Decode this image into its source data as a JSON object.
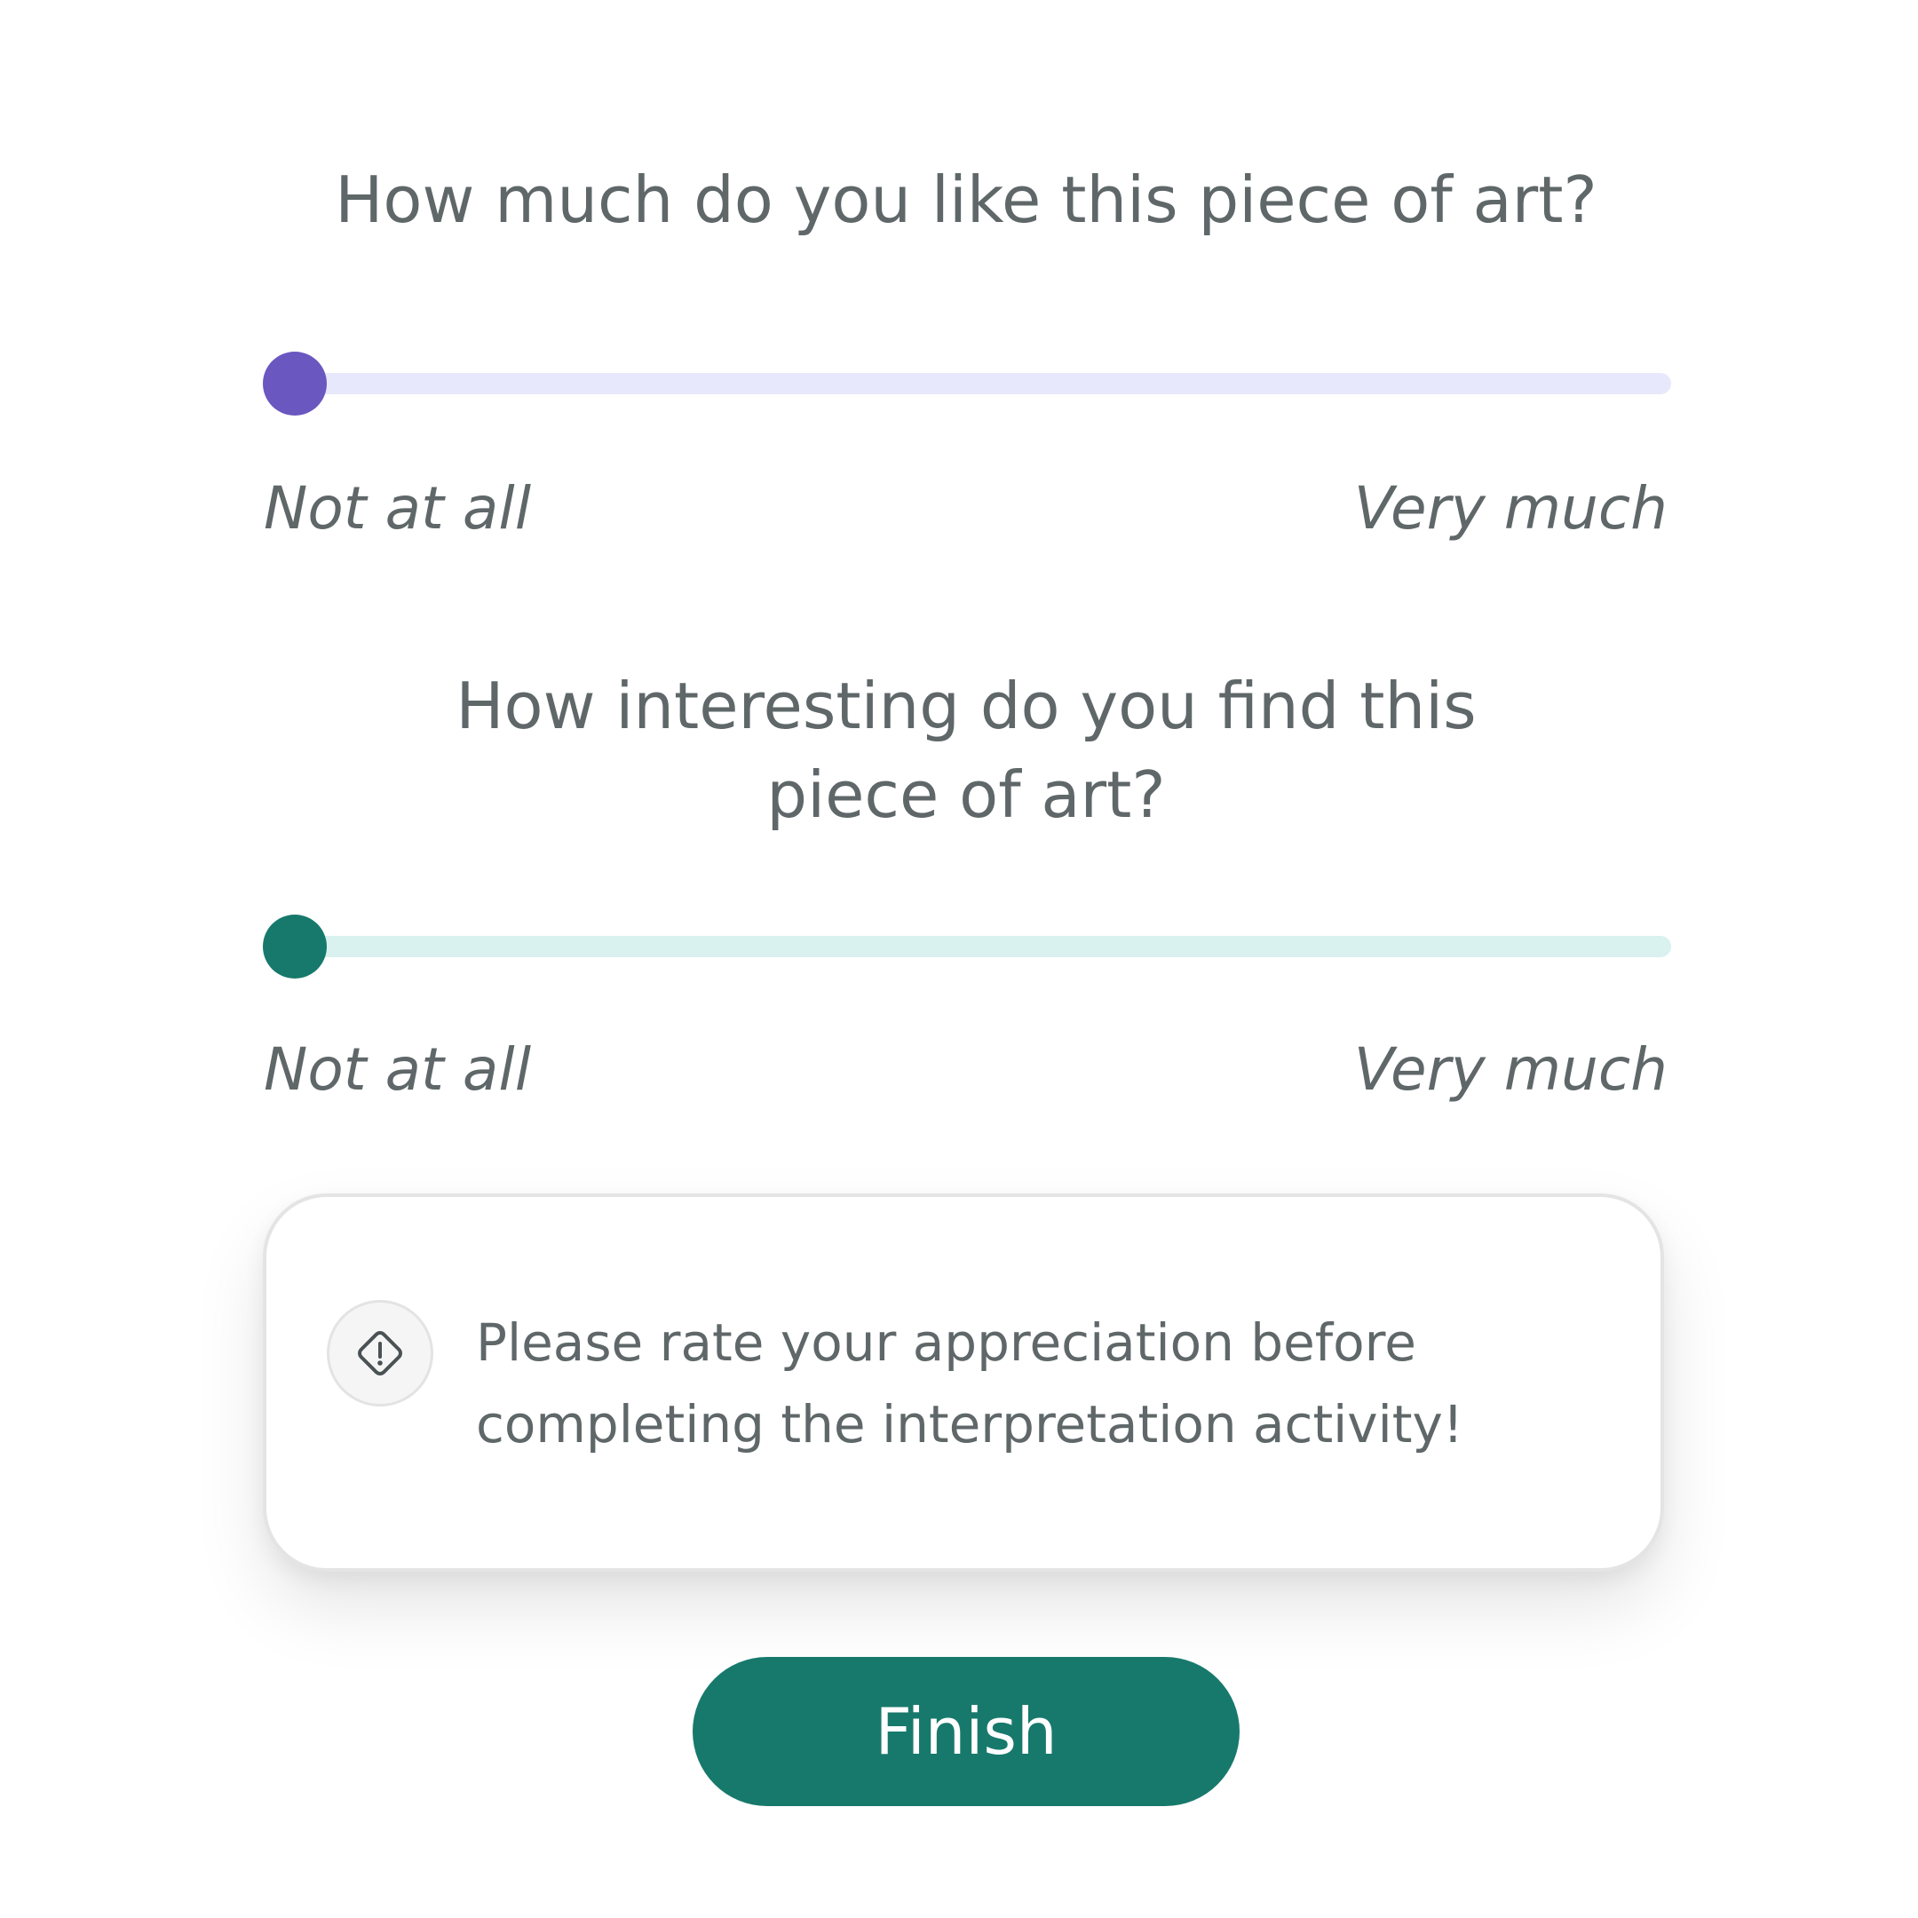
{
  "questions": [
    {
      "title": "How much do you like this piece of art?",
      "min_label": "Not at all",
      "max_label": "Very much",
      "value": 0,
      "accent_color": "#6a57c0",
      "track_color": "#e8e8fc"
    },
    {
      "title": "How interesting do you find this piece of art?",
      "min_label": "Not at all",
      "max_label": "Very much",
      "value": 0,
      "accent_color": "#17796c",
      "track_color": "#d9f1ef"
    }
  ],
  "alert": {
    "icon": "warning-diamond-icon",
    "message": "Please rate your appreciation before completing the interpretation activity!"
  },
  "finish_button": {
    "label": "Finish",
    "color": "#17796c"
  }
}
